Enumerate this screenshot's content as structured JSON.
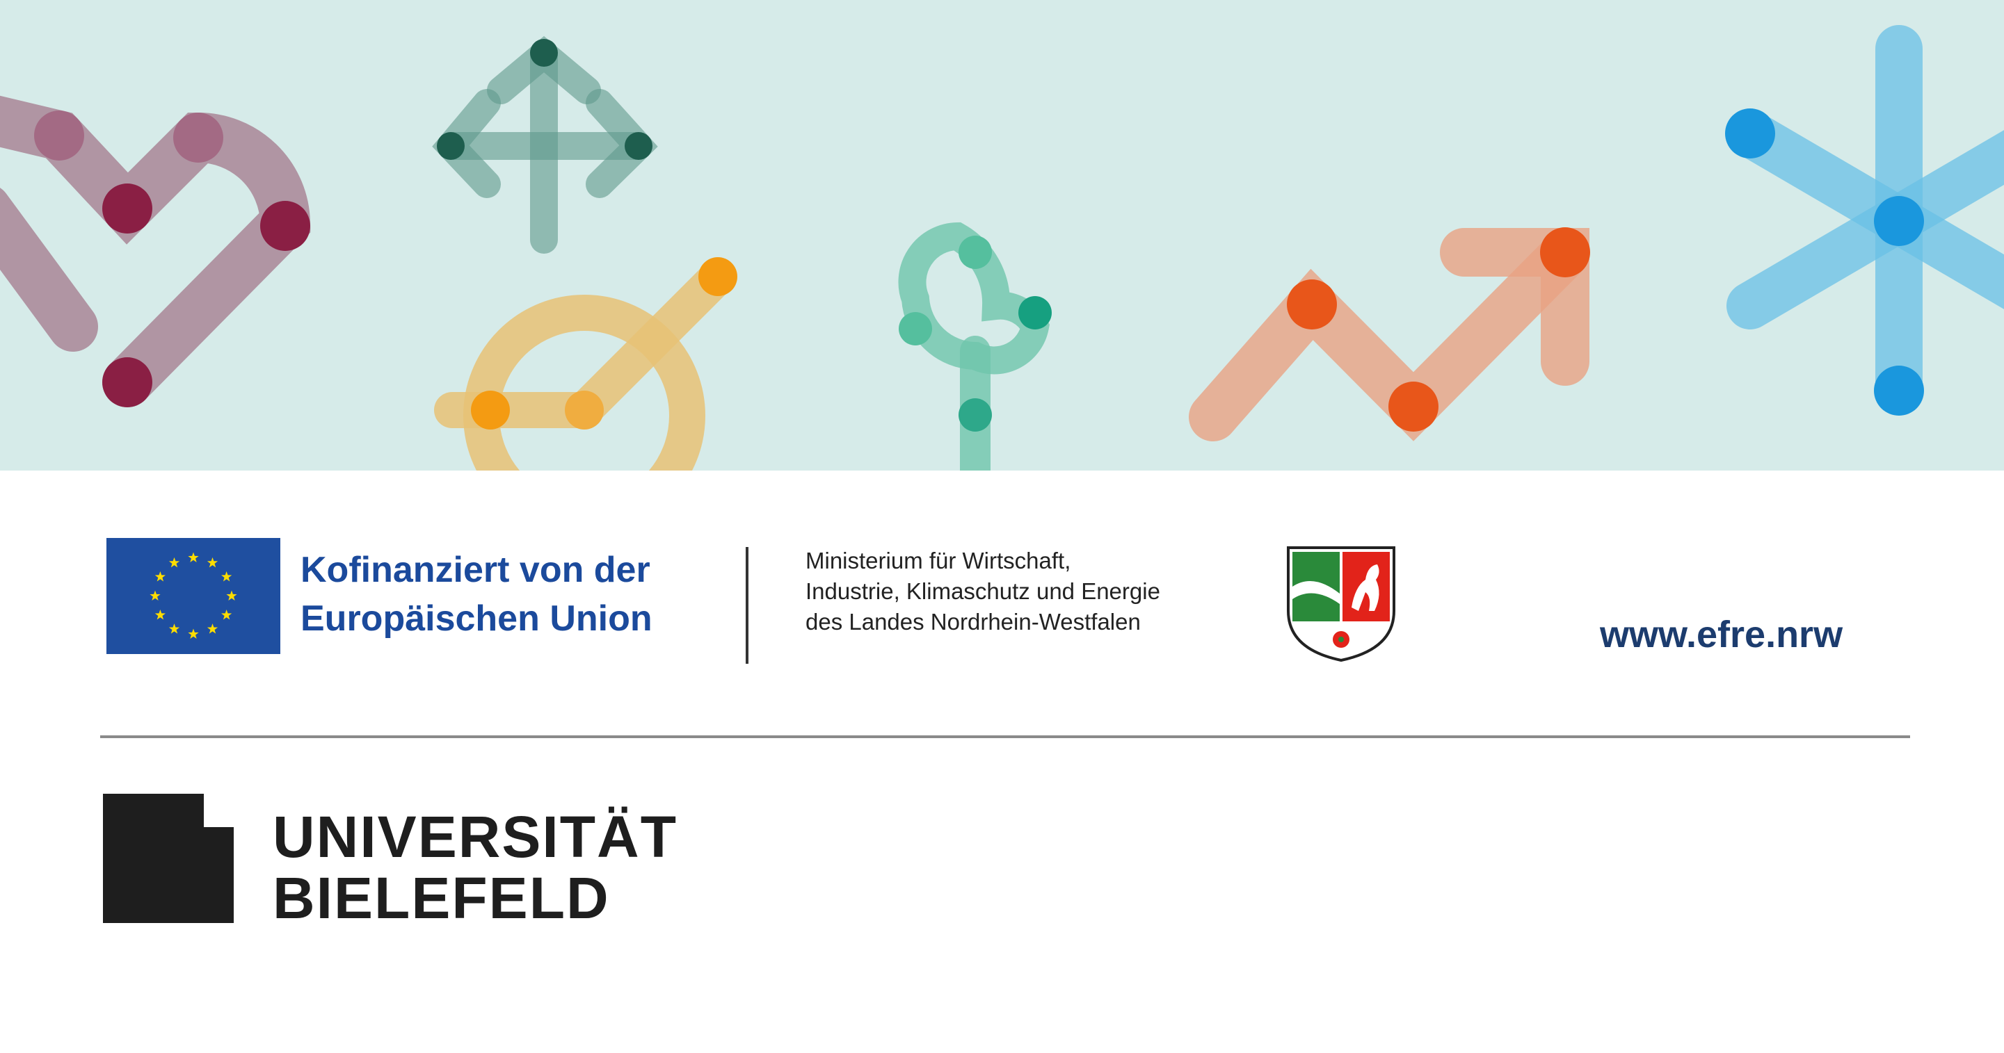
{
  "eu": {
    "line1": "Kofinanziert von der",
    "line2": "Europäischen Union",
    "flag_color": "#1f4fa0",
    "star_color": "#ffdd00",
    "text_color": "#1b4a9c"
  },
  "ministry": {
    "line1": "Ministerium für Wirtschaft,",
    "line2": "Industrie, Klimaschutz und Energie",
    "line3": "des Landes Nordrhein-Westfalen"
  },
  "efre": {
    "url": "www.efre.nrw",
    "color": "#1c3c6e"
  },
  "university": {
    "line1": "UNIVERSITÄT",
    "line2": "BIELEFELD"
  },
  "banner": {
    "background": "#d6ebe9",
    "icons": [
      "heart-icon",
      "arrows-icon",
      "target-icon",
      "tree-icon",
      "trend-arrow-icon",
      "asterisk-icon"
    ]
  }
}
